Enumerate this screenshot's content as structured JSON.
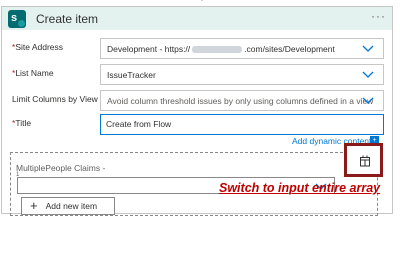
{
  "header": {
    "title": "Create item",
    "more_label": "···"
  },
  "fields": {
    "site_address": {
      "label": "Site Address",
      "required": "*",
      "value_prefix": "Development - https://",
      "value_suffix": ".com/sites/Development"
    },
    "list_name": {
      "label": "List Name",
      "required": "*",
      "value": "IssueTracker"
    },
    "limit_columns": {
      "label": "Limit Columns by View",
      "placeholder": "Avoid column threshold issues by only using columns defined in a view"
    },
    "title": {
      "label": "Title",
      "required": "*",
      "value": "Create from Flow"
    }
  },
  "dynamic_content": {
    "label": "Add dynamic content",
    "badge": "+"
  },
  "array_field": {
    "label": "MultiplePeople Claims -",
    "sub_marker": "1",
    "add_button_label": "Add new item",
    "add_icon": "plus-icon",
    "switch_icon": "switch-to-array-icon"
  },
  "annotation": {
    "text": "Switch to input entire array",
    "color": "#c00000"
  },
  "colors": {
    "accent": "#0078d4",
    "header_bg": "#e3f1ef",
    "logo": "#036c70",
    "highlight_box": "#8b1a1a"
  }
}
